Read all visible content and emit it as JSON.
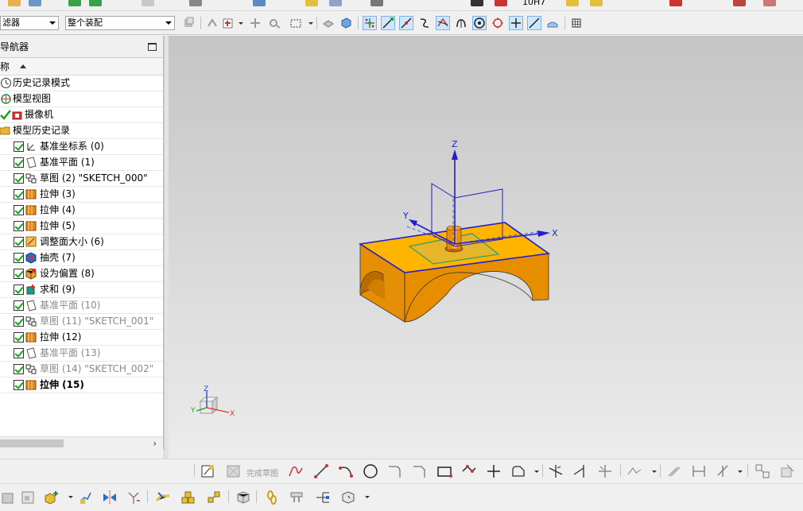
{
  "selection_bar": {
    "filter_label": "滤器",
    "assembly_scope": "整个装配"
  },
  "top_strip": {
    "value_text": "10H7"
  },
  "navigator": {
    "title": "导航器",
    "column_header": "称",
    "top_nodes": [
      {
        "label": "历史记录模式",
        "icon": "history-clock-icon"
      },
      {
        "label": "模型视图",
        "icon": "model-views-icon"
      },
      {
        "label": "摄像机",
        "icon": "camera-icon"
      },
      {
        "label": "模型历史记录",
        "icon": "folder-open-icon"
      }
    ],
    "features": [
      {
        "label": "基准坐标系 (0)",
        "icon": "datum-csys-icon",
        "style": "normal"
      },
      {
        "label": "基准平面 (1)",
        "icon": "datum-plane-icon",
        "style": "normal"
      },
      {
        "label": "草图 (2) \"SKETCH_000\"",
        "icon": "sketch-icon",
        "style": "normal"
      },
      {
        "label": "拉伸 (3)",
        "icon": "extrude-icon",
        "style": "normal"
      },
      {
        "label": "拉伸 (4)",
        "icon": "extrude-icon",
        "style": "normal"
      },
      {
        "label": "拉伸 (5)",
        "icon": "extrude-icon",
        "style": "normal"
      },
      {
        "label": "调整面大小 (6)",
        "icon": "resize-face-icon",
        "style": "normal"
      },
      {
        "label": "抽壳 (7)",
        "icon": "shell-icon",
        "style": "normal"
      },
      {
        "label": "设为偏置 (8)",
        "icon": "offset-icon",
        "style": "normal"
      },
      {
        "label": "求和 (9)",
        "icon": "unite-icon",
        "style": "normal"
      },
      {
        "label": "基准平面 (10)",
        "icon": "datum-plane-icon",
        "style": "dim"
      },
      {
        "label": "草图 (11) \"SKETCH_001\"",
        "icon": "sketch-icon",
        "style": "dim"
      },
      {
        "label": "拉伸 (12)",
        "icon": "extrude-icon",
        "style": "normal"
      },
      {
        "label": "基准平面 (13)",
        "icon": "datum-plane-icon",
        "style": "dim"
      },
      {
        "label": "草图 (14) \"SKETCH_002\"",
        "icon": "sketch-icon",
        "style": "dim"
      },
      {
        "label": "拉伸 (15)",
        "icon": "extrude-icon",
        "style": "bold"
      }
    ],
    "scroll_right": "›"
  },
  "viewport": {
    "axis_z": "Z",
    "axis_y": "Y",
    "axis_x": "X",
    "triad_z": "Z",
    "triad_y": "Y",
    "triad_x": "X"
  },
  "bottom_toolbar": {
    "finish_sketch_label": "完成草图"
  },
  "colors": {
    "part_top": "#ffb400",
    "part_side": "#e28a00",
    "axis_blue": "#1f1fd0",
    "sketch_green": "#2f9f6a"
  }
}
